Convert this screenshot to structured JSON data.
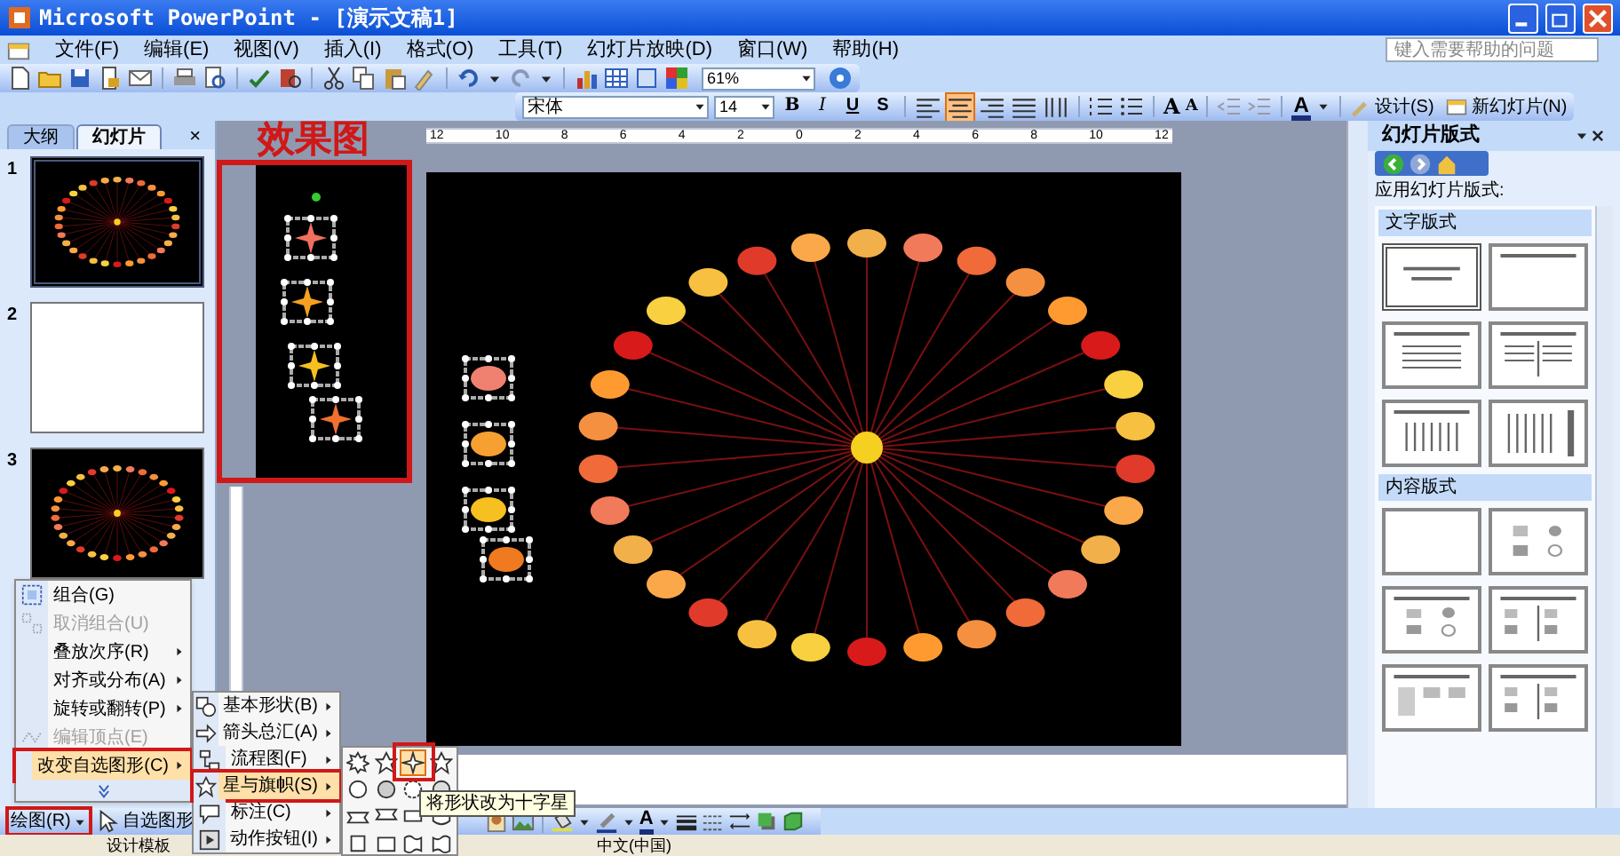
{
  "window": {
    "title": "Microsoft PowerPoint - [演示文稿1]"
  },
  "menu_bar": {
    "items": [
      "文件(F)",
      "编辑(E)",
      "视图(V)",
      "插入(I)",
      "格式(O)",
      "工具(T)",
      "幻灯片放映(D)",
      "窗口(W)",
      "帮助(H)"
    ],
    "help_placeholder": "键入需要帮助的问题"
  },
  "standard_toolbar": {
    "zoom": "61%"
  },
  "formatting_toolbar": {
    "font": "宋体",
    "size": "14",
    "styles": [
      "B",
      "I",
      "U",
      "S"
    ],
    "alignment": [
      {
        "kind": "left",
        "selected": false
      },
      {
        "kind": "center",
        "selected": true
      },
      {
        "kind": "right",
        "selected": false
      },
      {
        "kind": "justify",
        "selected": false
      },
      {
        "kind": "distributed",
        "selected": false
      }
    ],
    "grow_font": "A",
    "shrink_font": "A",
    "font_color": "A",
    "design": "设计(S)",
    "new_slide": "新幻灯片(N)"
  },
  "left_pane": {
    "tabs": [
      {
        "label": "大纲",
        "selected": false
      },
      {
        "label": "幻灯片",
        "selected": true
      }
    ],
    "close": "×",
    "slides": [
      {
        "number": "1",
        "selected": true,
        "kind": "rays"
      },
      {
        "number": "2",
        "selected": false,
        "kind": "blank"
      },
      {
        "number": "3",
        "selected": false,
        "kind": "rays"
      }
    ]
  },
  "ruler": {
    "labels": [
      "12",
      "10",
      "8",
      "6",
      "4",
      "2",
      "0",
      "2",
      "4",
      "6",
      "8",
      "10",
      "12"
    ]
  },
  "annotation": {
    "label": "效果图"
  },
  "task_pane": {
    "title": "幻灯片版式",
    "subtitle": "应用幻灯片版式:",
    "sections": [
      {
        "heading": "文字版式",
        "layouts": [
          {
            "kind": "title",
            "selected": true
          },
          {
            "kind": "title_only",
            "selected": false
          },
          {
            "kind": "title_text",
            "selected": false
          },
          {
            "kind": "two_column",
            "selected": false
          },
          {
            "kind": "vertical_text",
            "selected": false
          },
          {
            "kind": "vertical_title",
            "selected": false
          }
        ]
      },
      {
        "heading": "内容版式",
        "layouts": [
          {
            "kind": "blank",
            "selected": false
          },
          {
            "kind": "content",
            "selected": false
          },
          {
            "kind": "title_content",
            "selected": false
          },
          {
            "kind": "two_content",
            "selected": false
          },
          {
            "kind": "three_content",
            "selected": false
          },
          {
            "kind": "two_content",
            "selected": false
          }
        ]
      }
    ]
  },
  "draw_menu": {
    "items": [
      {
        "label": "组合(G)",
        "disabled": false,
        "submenu": false,
        "selected": false
      },
      {
        "label": "取消组合(U)",
        "disabled": true,
        "submenu": false,
        "selected": false
      },
      {
        "label": "叠放次序(R)",
        "disabled": false,
        "submenu": true,
        "selected": false
      },
      {
        "label": "对齐或分布(A)",
        "disabled": false,
        "submenu": true,
        "selected": false
      },
      {
        "label": "旋转或翻转(P)",
        "disabled": false,
        "submenu": true,
        "selected": false
      },
      {
        "label": "编辑顶点(E)",
        "disabled": true,
        "submenu": false,
        "selected": false
      },
      {
        "label": "改变自选图形(C)",
        "disabled": false,
        "submenu": true,
        "selected": true
      }
    ]
  },
  "autoshape_menu": {
    "items": [
      {
        "label": "基本形状(B)",
        "selected": false
      },
      {
        "label": "箭头总汇(A)",
        "selected": false
      },
      {
        "label": "流程图(F)",
        "selected": false
      },
      {
        "label": "星与旗帜(S)",
        "selected": true
      },
      {
        "label": "标注(C)",
        "selected": false
      },
      {
        "label": "动作按钮(I)",
        "selected": false
      }
    ]
  },
  "shape_palette": {
    "tooltip": "将形状改为十字星"
  },
  "drawing_toolbar": {
    "draw": "绘图(R)",
    "autoshapes": "自选图形",
    "font_color": "A"
  },
  "status_bar": {
    "items": [
      "设计模板",
      "中文(中国)"
    ]
  }
}
